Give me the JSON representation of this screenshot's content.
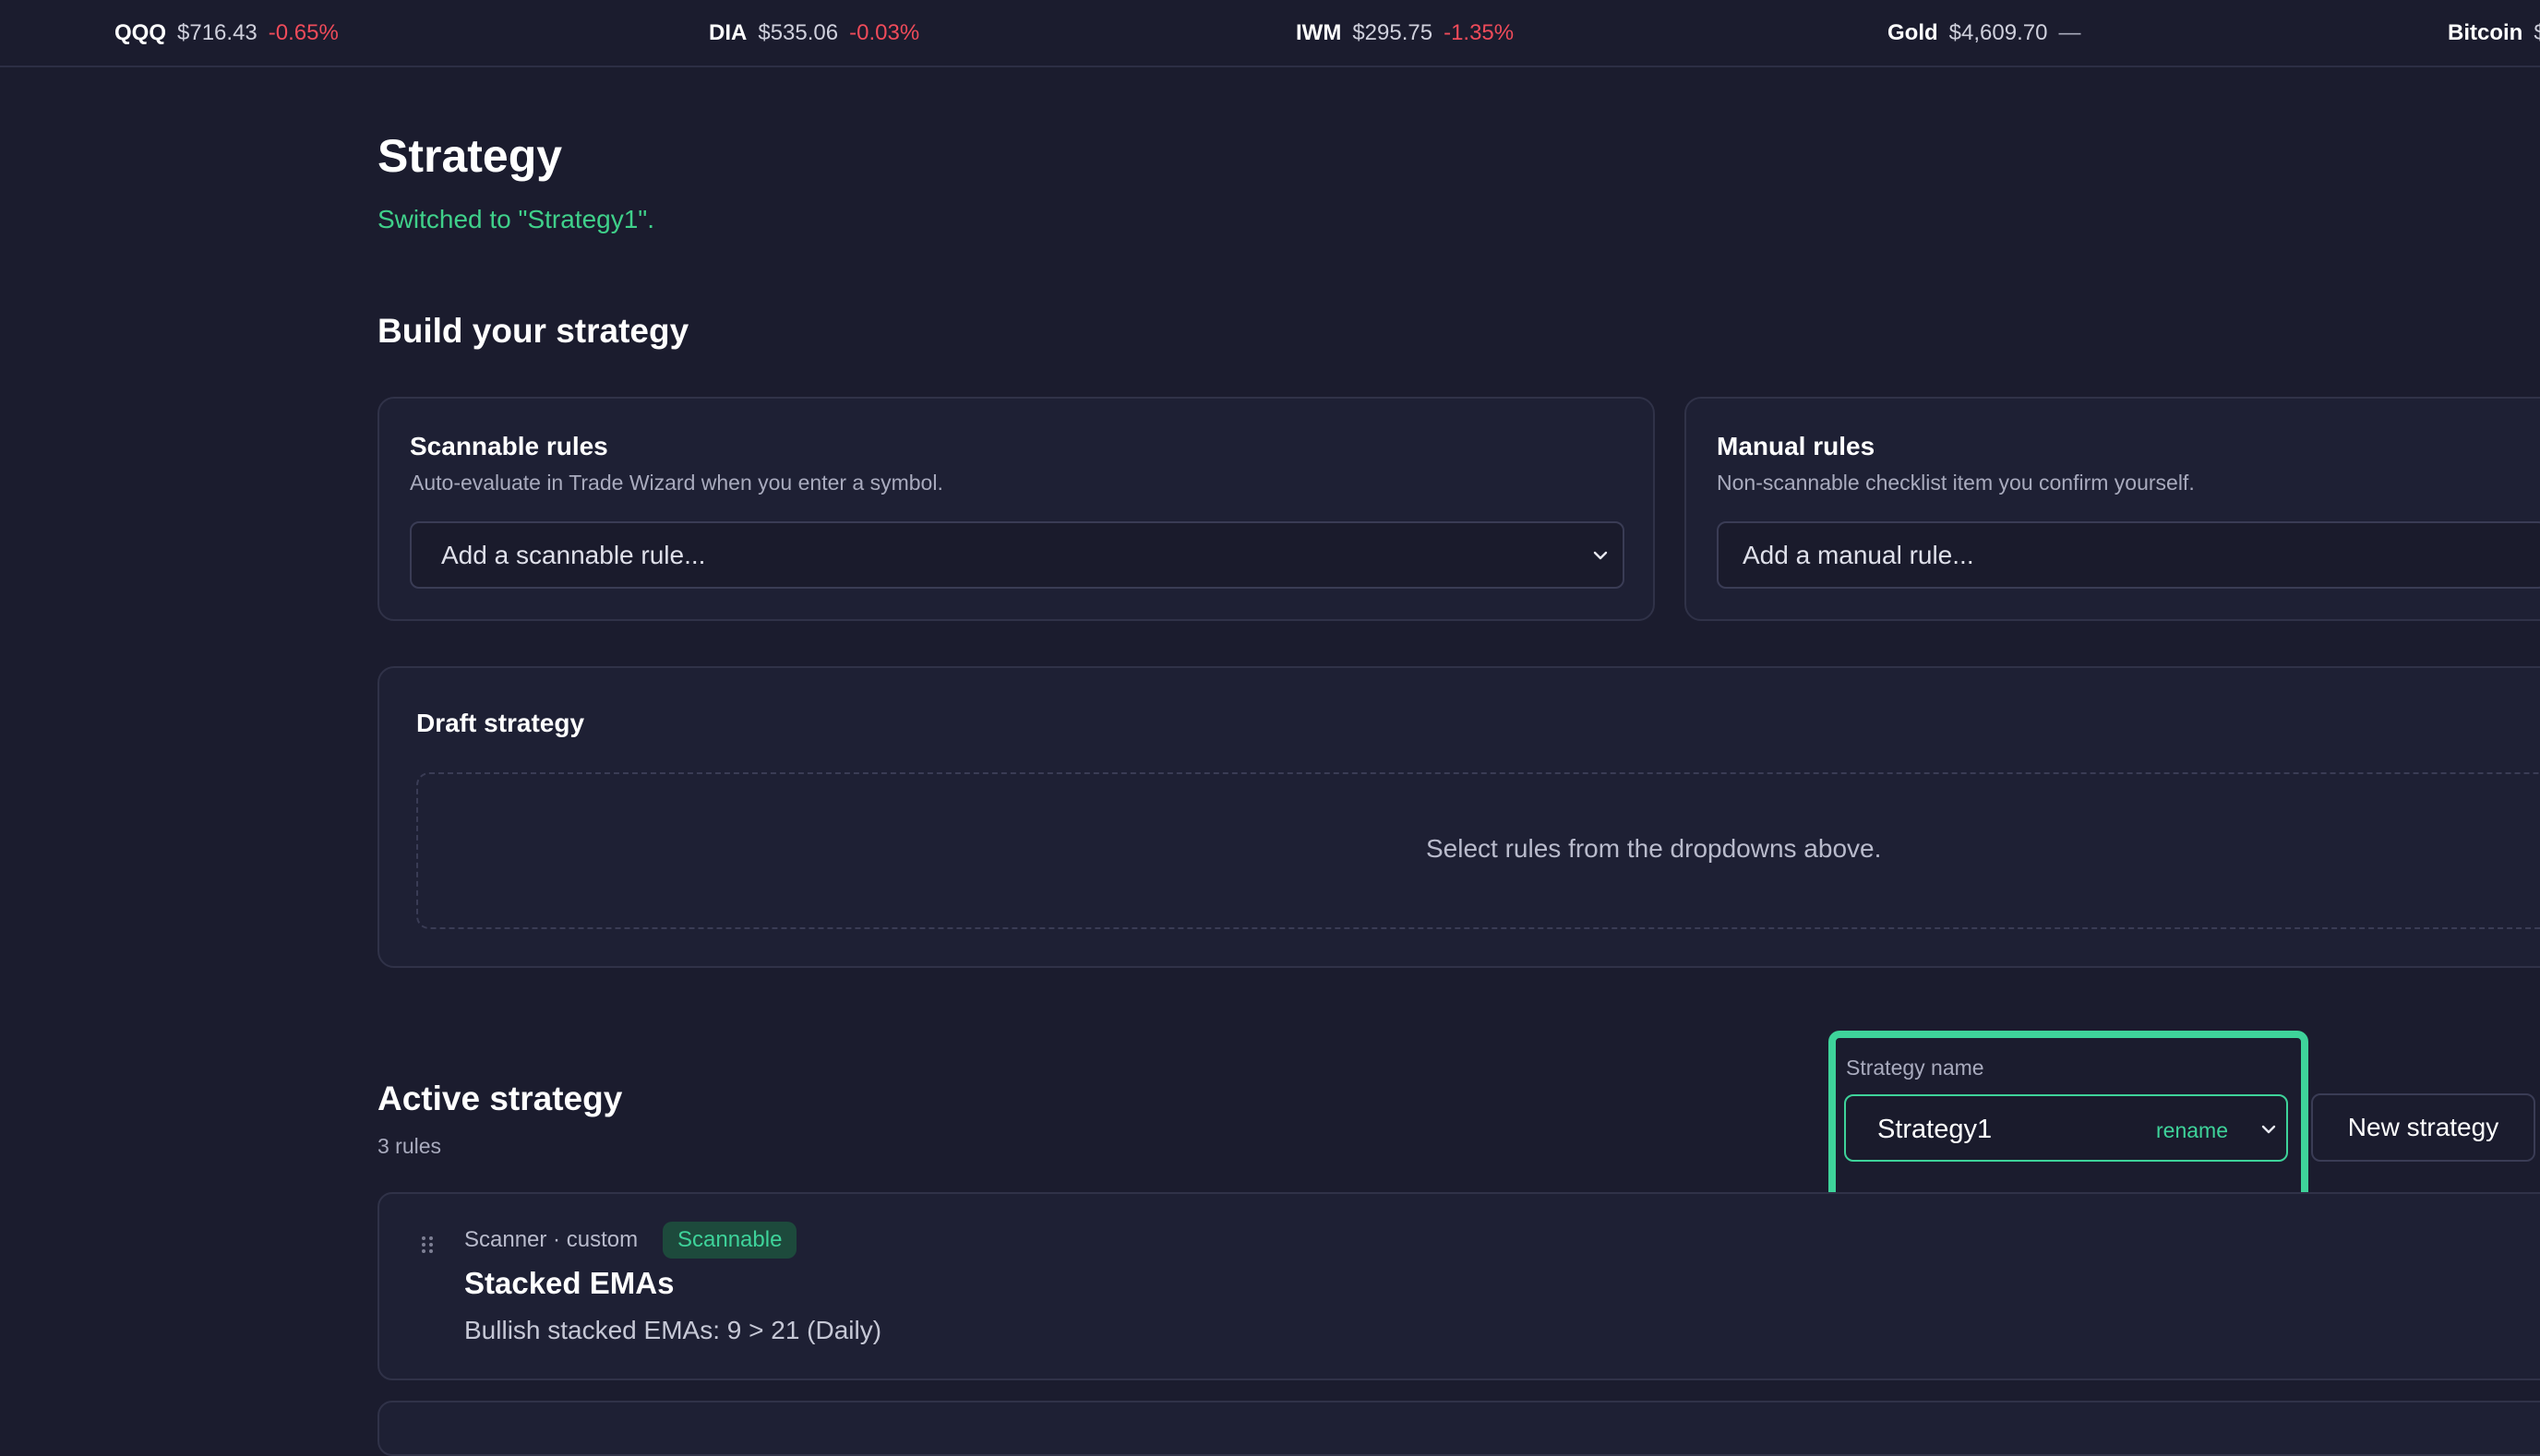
{
  "ticker": [
    {
      "symbol": "QQQ",
      "price": "$716.43",
      "change": "-0.65%",
      "direction": "neg"
    },
    {
      "symbol": "DIA",
      "price": "$535.06",
      "change": "-0.03%",
      "direction": "neg"
    },
    {
      "symbol": "IWM",
      "price": "$295.75",
      "change": "-1.35%",
      "direction": "neg"
    },
    {
      "symbol": "Gold",
      "price": "$4,609.70",
      "change": "—",
      "direction": "flat"
    },
    {
      "symbol": "Bitcoin",
      "price": "$",
      "change": "",
      "direction": "flat"
    }
  ],
  "page": {
    "title": "Strategy",
    "status_message": "Switched to \"Strategy1\"."
  },
  "build": {
    "heading": "Build your strategy",
    "scannable": {
      "title": "Scannable rules",
      "subtitle": "Auto-evaluate in Trade Wizard when you enter a symbol.",
      "placeholder": "Add a scannable rule..."
    },
    "manual": {
      "title": "Manual rules",
      "subtitle": "Non-scannable checklist item you confirm yourself.",
      "placeholder": "Add a manual rule..."
    }
  },
  "draft": {
    "title": "Draft strategy",
    "empty_message": "Select rules from the dropdowns above."
  },
  "active": {
    "heading": "Active strategy",
    "rule_count": "3 rules",
    "name_label": "Strategy name",
    "name_value": "Strategy1",
    "rename_label": "rename",
    "new_button": "New strategy",
    "rules": [
      {
        "meta": "Scanner · custom",
        "badge": "Scannable",
        "title": "Stacked EMAs",
        "description": "Bullish stacked EMAs: 9 > 21 (Daily)"
      }
    ]
  },
  "colors": {
    "background": "#1b1c2e",
    "accent_green": "#3ed39a",
    "negative_red": "#ef4b5a"
  }
}
